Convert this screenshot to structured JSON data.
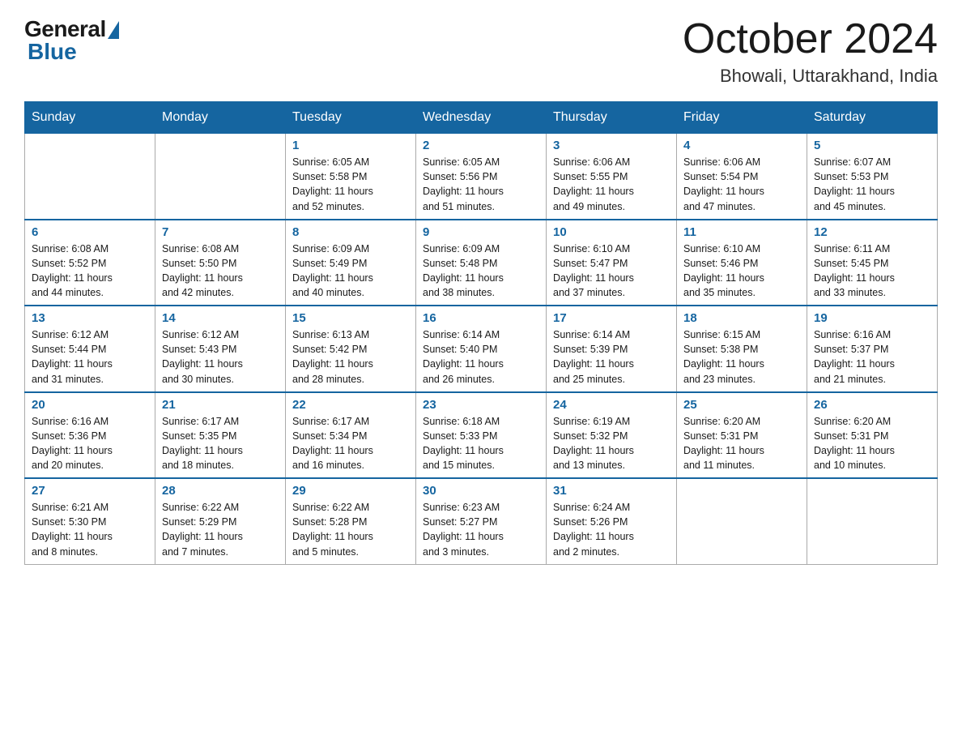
{
  "logo": {
    "general": "General",
    "blue": "Blue"
  },
  "title": {
    "month": "October 2024",
    "location": "Bhowali, Uttarakhand, India"
  },
  "headers": [
    "Sunday",
    "Monday",
    "Tuesday",
    "Wednesday",
    "Thursday",
    "Friday",
    "Saturday"
  ],
  "weeks": [
    [
      {
        "day": "",
        "info": ""
      },
      {
        "day": "",
        "info": ""
      },
      {
        "day": "1",
        "info": "Sunrise: 6:05 AM\nSunset: 5:58 PM\nDaylight: 11 hours\nand 52 minutes."
      },
      {
        "day": "2",
        "info": "Sunrise: 6:05 AM\nSunset: 5:56 PM\nDaylight: 11 hours\nand 51 minutes."
      },
      {
        "day": "3",
        "info": "Sunrise: 6:06 AM\nSunset: 5:55 PM\nDaylight: 11 hours\nand 49 minutes."
      },
      {
        "day": "4",
        "info": "Sunrise: 6:06 AM\nSunset: 5:54 PM\nDaylight: 11 hours\nand 47 minutes."
      },
      {
        "day": "5",
        "info": "Sunrise: 6:07 AM\nSunset: 5:53 PM\nDaylight: 11 hours\nand 45 minutes."
      }
    ],
    [
      {
        "day": "6",
        "info": "Sunrise: 6:08 AM\nSunset: 5:52 PM\nDaylight: 11 hours\nand 44 minutes."
      },
      {
        "day": "7",
        "info": "Sunrise: 6:08 AM\nSunset: 5:50 PM\nDaylight: 11 hours\nand 42 minutes."
      },
      {
        "day": "8",
        "info": "Sunrise: 6:09 AM\nSunset: 5:49 PM\nDaylight: 11 hours\nand 40 minutes."
      },
      {
        "day": "9",
        "info": "Sunrise: 6:09 AM\nSunset: 5:48 PM\nDaylight: 11 hours\nand 38 minutes."
      },
      {
        "day": "10",
        "info": "Sunrise: 6:10 AM\nSunset: 5:47 PM\nDaylight: 11 hours\nand 37 minutes."
      },
      {
        "day": "11",
        "info": "Sunrise: 6:10 AM\nSunset: 5:46 PM\nDaylight: 11 hours\nand 35 minutes."
      },
      {
        "day": "12",
        "info": "Sunrise: 6:11 AM\nSunset: 5:45 PM\nDaylight: 11 hours\nand 33 minutes."
      }
    ],
    [
      {
        "day": "13",
        "info": "Sunrise: 6:12 AM\nSunset: 5:44 PM\nDaylight: 11 hours\nand 31 minutes."
      },
      {
        "day": "14",
        "info": "Sunrise: 6:12 AM\nSunset: 5:43 PM\nDaylight: 11 hours\nand 30 minutes."
      },
      {
        "day": "15",
        "info": "Sunrise: 6:13 AM\nSunset: 5:42 PM\nDaylight: 11 hours\nand 28 minutes."
      },
      {
        "day": "16",
        "info": "Sunrise: 6:14 AM\nSunset: 5:40 PM\nDaylight: 11 hours\nand 26 minutes."
      },
      {
        "day": "17",
        "info": "Sunrise: 6:14 AM\nSunset: 5:39 PM\nDaylight: 11 hours\nand 25 minutes."
      },
      {
        "day": "18",
        "info": "Sunrise: 6:15 AM\nSunset: 5:38 PM\nDaylight: 11 hours\nand 23 minutes."
      },
      {
        "day": "19",
        "info": "Sunrise: 6:16 AM\nSunset: 5:37 PM\nDaylight: 11 hours\nand 21 minutes."
      }
    ],
    [
      {
        "day": "20",
        "info": "Sunrise: 6:16 AM\nSunset: 5:36 PM\nDaylight: 11 hours\nand 20 minutes."
      },
      {
        "day": "21",
        "info": "Sunrise: 6:17 AM\nSunset: 5:35 PM\nDaylight: 11 hours\nand 18 minutes."
      },
      {
        "day": "22",
        "info": "Sunrise: 6:17 AM\nSunset: 5:34 PM\nDaylight: 11 hours\nand 16 minutes."
      },
      {
        "day": "23",
        "info": "Sunrise: 6:18 AM\nSunset: 5:33 PM\nDaylight: 11 hours\nand 15 minutes."
      },
      {
        "day": "24",
        "info": "Sunrise: 6:19 AM\nSunset: 5:32 PM\nDaylight: 11 hours\nand 13 minutes."
      },
      {
        "day": "25",
        "info": "Sunrise: 6:20 AM\nSunset: 5:31 PM\nDaylight: 11 hours\nand 11 minutes."
      },
      {
        "day": "26",
        "info": "Sunrise: 6:20 AM\nSunset: 5:31 PM\nDaylight: 11 hours\nand 10 minutes."
      }
    ],
    [
      {
        "day": "27",
        "info": "Sunrise: 6:21 AM\nSunset: 5:30 PM\nDaylight: 11 hours\nand 8 minutes."
      },
      {
        "day": "28",
        "info": "Sunrise: 6:22 AM\nSunset: 5:29 PM\nDaylight: 11 hours\nand 7 minutes."
      },
      {
        "day": "29",
        "info": "Sunrise: 6:22 AM\nSunset: 5:28 PM\nDaylight: 11 hours\nand 5 minutes."
      },
      {
        "day": "30",
        "info": "Sunrise: 6:23 AM\nSunset: 5:27 PM\nDaylight: 11 hours\nand 3 minutes."
      },
      {
        "day": "31",
        "info": "Sunrise: 6:24 AM\nSunset: 5:26 PM\nDaylight: 11 hours\nand 2 minutes."
      },
      {
        "day": "",
        "info": ""
      },
      {
        "day": "",
        "info": ""
      }
    ]
  ]
}
